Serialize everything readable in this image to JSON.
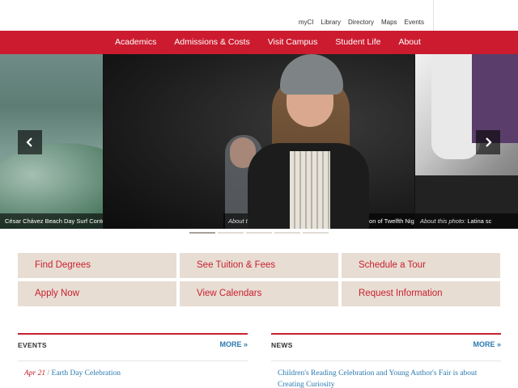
{
  "util_links": [
    "myCI",
    "Library",
    "Directory",
    "Maps",
    "Events"
  ],
  "main_nav": [
    "Academics",
    "Admissions & Costs",
    "Visit Campus",
    "Student Life",
    "About"
  ],
  "slider": {
    "caption_prefix": "About this photo:",
    "slides": [
      {
        "caption_text": "César Chávez Beach Day Surf Contest"
      },
      {
        "caption_text": "Students rehearse for CI's production of Twelfth Night"
      },
      {
        "caption_text": "Latina sc"
      }
    ],
    "indicator_count": 5,
    "active_indicator": 1
  },
  "quick_links": [
    "Find Degrees",
    "See Tuition & Fees",
    "Schedule a Tour",
    "Apply Now",
    "View Calendars",
    "Request Information"
  ],
  "events": {
    "title": "EVENTS",
    "more": "MORE »",
    "items": [
      {
        "date": "Apr 21",
        "separator": "/",
        "title": "Earth Day Celebration"
      }
    ]
  },
  "news": {
    "title": "NEWS",
    "more": "MORE »",
    "items": [
      {
        "title": "Children's Reading Celebration and Young Author's Fair is about Creating Curiosity"
      }
    ]
  },
  "colors": {
    "brand_red": "#cc1b2f",
    "link_blue": "#2a7ab0",
    "tan": "#e8ddd3"
  }
}
